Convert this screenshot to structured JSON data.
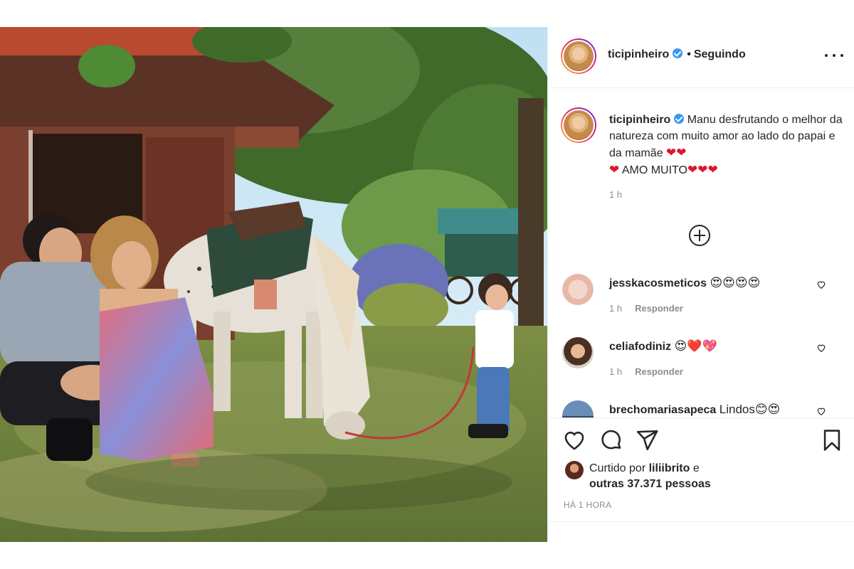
{
  "post": {
    "username": "ticipinheiro",
    "follow_status": "Seguindo",
    "separator": "•"
  },
  "caption": {
    "username": "ticipinheiro",
    "text_part1": "Manu desfrutando o melhor da natureza com muito amor ao lado do papai e da mamãe",
    "text_part2": "AMO MUITO",
    "time": "1 h"
  },
  "comments": [
    {
      "username": "jesskacosmeticos",
      "text": "😍😍😍😍",
      "time": "1 h",
      "reply_label": "Responder"
    },
    {
      "username": "celiafodiniz",
      "text": "😍❤️💖",
      "time": "1 h",
      "reply_label": "Responder"
    },
    {
      "username": "brechomariasapeca",
      "text": "Lindos😊😍",
      "time": "",
      "reply_label": ""
    }
  ],
  "likes": {
    "prefix": "Curtido por",
    "liked_by": "liliibrito",
    "conjunction": "e",
    "others": "outras 37.371 pessoas"
  },
  "time_ago": "HÁ 1 HORA",
  "icons": [
    "verified-badge",
    "more-options",
    "add-circle",
    "heart",
    "comment",
    "share",
    "save"
  ],
  "colors": {
    "verified": "#3897f0",
    "heart": "#e0152b",
    "text": "#262626",
    "muted": "#8e8e8e",
    "border": "#efefef"
  }
}
